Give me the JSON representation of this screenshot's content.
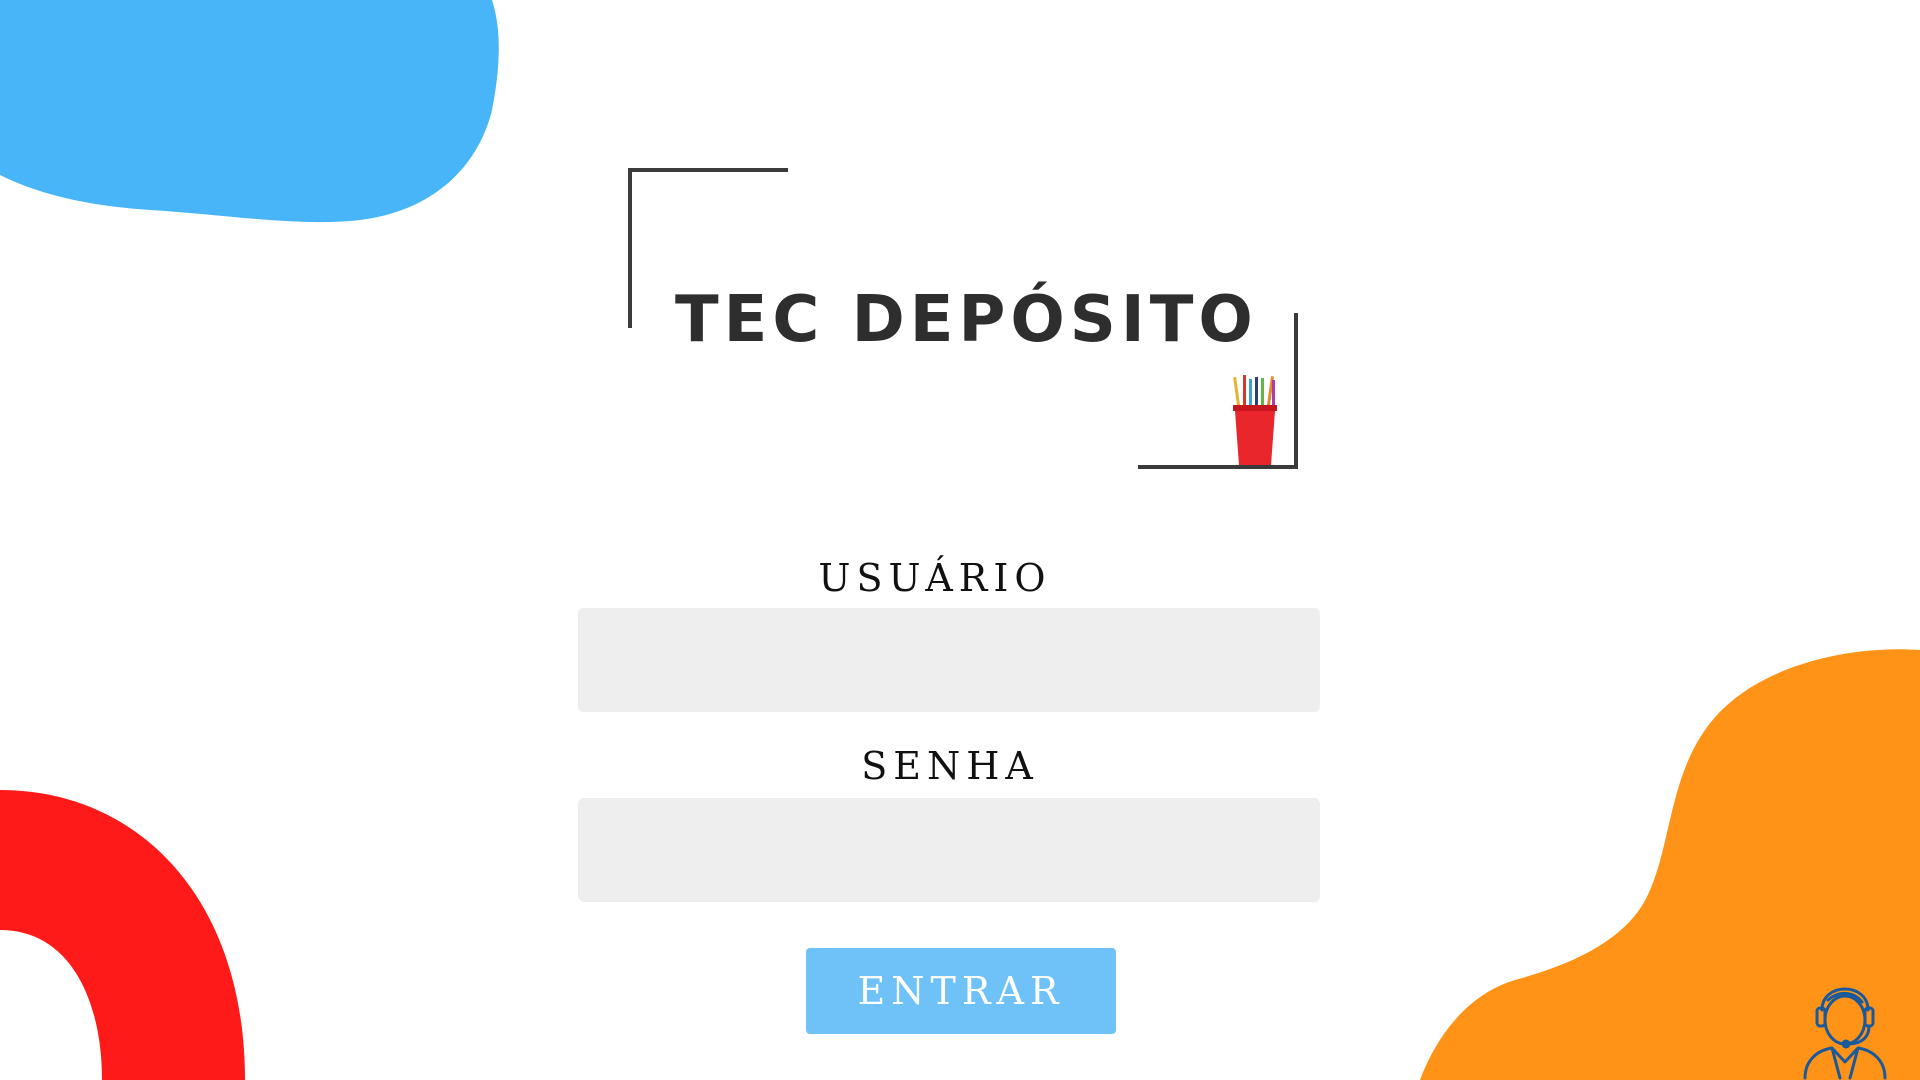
{
  "logo": {
    "text": "TEC DEPÓSITO"
  },
  "form": {
    "user_label": "USUÁRIO",
    "user_value": "",
    "password_label": "SENHA",
    "password_value": "",
    "submit_label": "ENTRAR"
  },
  "icons": {
    "support": "headset-support-icon",
    "pencil_cup": "pencil-cup-icon"
  },
  "colors": {
    "blue_blob": "#47b5f7",
    "red_ring": "#ff1a1a",
    "orange_blob": "#ff9318",
    "button": "#6ec2f7",
    "input_bg": "#eeeeee",
    "support_icon": "#1a5a9a"
  }
}
